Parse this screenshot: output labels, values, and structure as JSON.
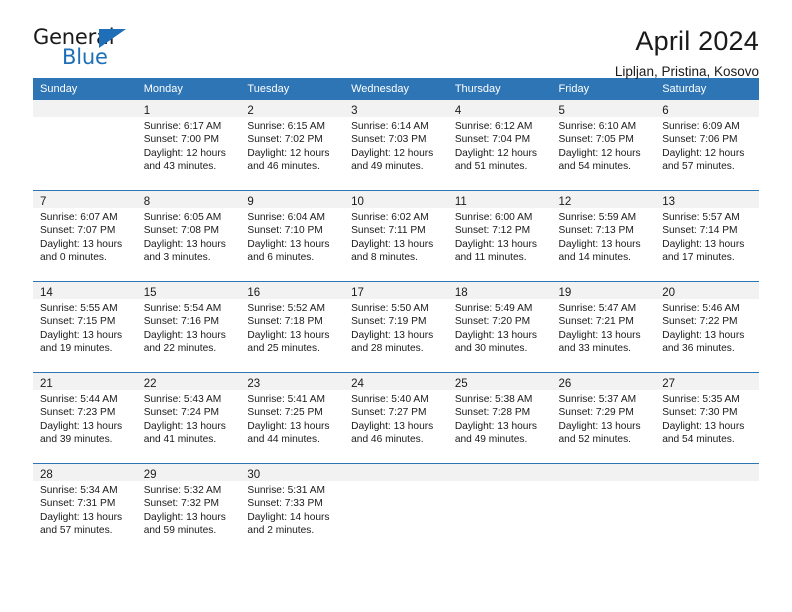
{
  "brand": {
    "name_part1": "General",
    "name_part2": "Blue",
    "accent_color": "#1E6FB8"
  },
  "header": {
    "title": "April 2024",
    "subtitle": "Lipljan, Pristina, Kosovo",
    "header_bg_color": "#2E75B6",
    "daynum_band_color": "#F2F2F2"
  },
  "weekday_headers": [
    "Sunday",
    "Monday",
    "Tuesday",
    "Wednesday",
    "Thursday",
    "Friday",
    "Saturday"
  ],
  "weeks": [
    [
      {
        "day": "",
        "sunrise": "",
        "sunset": "",
        "daylight_line1": "",
        "daylight_line2": ""
      },
      {
        "day": "1",
        "sunrise": "Sunrise: 6:17 AM",
        "sunset": "Sunset: 7:00 PM",
        "daylight_line1": "Daylight: 12 hours",
        "daylight_line2": "and 43 minutes."
      },
      {
        "day": "2",
        "sunrise": "Sunrise: 6:15 AM",
        "sunset": "Sunset: 7:02 PM",
        "daylight_line1": "Daylight: 12 hours",
        "daylight_line2": "and 46 minutes."
      },
      {
        "day": "3",
        "sunrise": "Sunrise: 6:14 AM",
        "sunset": "Sunset: 7:03 PM",
        "daylight_line1": "Daylight: 12 hours",
        "daylight_line2": "and 49 minutes."
      },
      {
        "day": "4",
        "sunrise": "Sunrise: 6:12 AM",
        "sunset": "Sunset: 7:04 PM",
        "daylight_line1": "Daylight: 12 hours",
        "daylight_line2": "and 51 minutes."
      },
      {
        "day": "5",
        "sunrise": "Sunrise: 6:10 AM",
        "sunset": "Sunset: 7:05 PM",
        "daylight_line1": "Daylight: 12 hours",
        "daylight_line2": "and 54 minutes."
      },
      {
        "day": "6",
        "sunrise": "Sunrise: 6:09 AM",
        "sunset": "Sunset: 7:06 PM",
        "daylight_line1": "Daylight: 12 hours",
        "daylight_line2": "and 57 minutes."
      }
    ],
    [
      {
        "day": "7",
        "sunrise": "Sunrise: 6:07 AM",
        "sunset": "Sunset: 7:07 PM",
        "daylight_line1": "Daylight: 13 hours",
        "daylight_line2": "and 0 minutes."
      },
      {
        "day": "8",
        "sunrise": "Sunrise: 6:05 AM",
        "sunset": "Sunset: 7:08 PM",
        "daylight_line1": "Daylight: 13 hours",
        "daylight_line2": "and 3 minutes."
      },
      {
        "day": "9",
        "sunrise": "Sunrise: 6:04 AM",
        "sunset": "Sunset: 7:10 PM",
        "daylight_line1": "Daylight: 13 hours",
        "daylight_line2": "and 6 minutes."
      },
      {
        "day": "10",
        "sunrise": "Sunrise: 6:02 AM",
        "sunset": "Sunset: 7:11 PM",
        "daylight_line1": "Daylight: 13 hours",
        "daylight_line2": "and 8 minutes."
      },
      {
        "day": "11",
        "sunrise": "Sunrise: 6:00 AM",
        "sunset": "Sunset: 7:12 PM",
        "daylight_line1": "Daylight: 13 hours",
        "daylight_line2": "and 11 minutes."
      },
      {
        "day": "12",
        "sunrise": "Sunrise: 5:59 AM",
        "sunset": "Sunset: 7:13 PM",
        "daylight_line1": "Daylight: 13 hours",
        "daylight_line2": "and 14 minutes."
      },
      {
        "day": "13",
        "sunrise": "Sunrise: 5:57 AM",
        "sunset": "Sunset: 7:14 PM",
        "daylight_line1": "Daylight: 13 hours",
        "daylight_line2": "and 17 minutes."
      }
    ],
    [
      {
        "day": "14",
        "sunrise": "Sunrise: 5:55 AM",
        "sunset": "Sunset: 7:15 PM",
        "daylight_line1": "Daylight: 13 hours",
        "daylight_line2": "and 19 minutes."
      },
      {
        "day": "15",
        "sunrise": "Sunrise: 5:54 AM",
        "sunset": "Sunset: 7:16 PM",
        "daylight_line1": "Daylight: 13 hours",
        "daylight_line2": "and 22 minutes."
      },
      {
        "day": "16",
        "sunrise": "Sunrise: 5:52 AM",
        "sunset": "Sunset: 7:18 PM",
        "daylight_line1": "Daylight: 13 hours",
        "daylight_line2": "and 25 minutes."
      },
      {
        "day": "17",
        "sunrise": "Sunrise: 5:50 AM",
        "sunset": "Sunset: 7:19 PM",
        "daylight_line1": "Daylight: 13 hours",
        "daylight_line2": "and 28 minutes."
      },
      {
        "day": "18",
        "sunrise": "Sunrise: 5:49 AM",
        "sunset": "Sunset: 7:20 PM",
        "daylight_line1": "Daylight: 13 hours",
        "daylight_line2": "and 30 minutes."
      },
      {
        "day": "19",
        "sunrise": "Sunrise: 5:47 AM",
        "sunset": "Sunset: 7:21 PM",
        "daylight_line1": "Daylight: 13 hours",
        "daylight_line2": "and 33 minutes."
      },
      {
        "day": "20",
        "sunrise": "Sunrise: 5:46 AM",
        "sunset": "Sunset: 7:22 PM",
        "daylight_line1": "Daylight: 13 hours",
        "daylight_line2": "and 36 minutes."
      }
    ],
    [
      {
        "day": "21",
        "sunrise": "Sunrise: 5:44 AM",
        "sunset": "Sunset: 7:23 PM",
        "daylight_line1": "Daylight: 13 hours",
        "daylight_line2": "and 39 minutes."
      },
      {
        "day": "22",
        "sunrise": "Sunrise: 5:43 AM",
        "sunset": "Sunset: 7:24 PM",
        "daylight_line1": "Daylight: 13 hours",
        "daylight_line2": "and 41 minutes."
      },
      {
        "day": "23",
        "sunrise": "Sunrise: 5:41 AM",
        "sunset": "Sunset: 7:25 PM",
        "daylight_line1": "Daylight: 13 hours",
        "daylight_line2": "and 44 minutes."
      },
      {
        "day": "24",
        "sunrise": "Sunrise: 5:40 AM",
        "sunset": "Sunset: 7:27 PM",
        "daylight_line1": "Daylight: 13 hours",
        "daylight_line2": "and 46 minutes."
      },
      {
        "day": "25",
        "sunrise": "Sunrise: 5:38 AM",
        "sunset": "Sunset: 7:28 PM",
        "daylight_line1": "Daylight: 13 hours",
        "daylight_line2": "and 49 minutes."
      },
      {
        "day": "26",
        "sunrise": "Sunrise: 5:37 AM",
        "sunset": "Sunset: 7:29 PM",
        "daylight_line1": "Daylight: 13 hours",
        "daylight_line2": "and 52 minutes."
      },
      {
        "day": "27",
        "sunrise": "Sunrise: 5:35 AM",
        "sunset": "Sunset: 7:30 PM",
        "daylight_line1": "Daylight: 13 hours",
        "daylight_line2": "and 54 minutes."
      }
    ],
    [
      {
        "day": "28",
        "sunrise": "Sunrise: 5:34 AM",
        "sunset": "Sunset: 7:31 PM",
        "daylight_line1": "Daylight: 13 hours",
        "daylight_line2": "and 57 minutes."
      },
      {
        "day": "29",
        "sunrise": "Sunrise: 5:32 AM",
        "sunset": "Sunset: 7:32 PM",
        "daylight_line1": "Daylight: 13 hours",
        "daylight_line2": "and 59 minutes."
      },
      {
        "day": "30",
        "sunrise": "Sunrise: 5:31 AM",
        "sunset": "Sunset: 7:33 PM",
        "daylight_line1": "Daylight: 14 hours",
        "daylight_line2": "and 2 minutes."
      },
      {
        "day": "",
        "sunrise": "",
        "sunset": "",
        "daylight_line1": "",
        "daylight_line2": ""
      },
      {
        "day": "",
        "sunrise": "",
        "sunset": "",
        "daylight_line1": "",
        "daylight_line2": ""
      },
      {
        "day": "",
        "sunrise": "",
        "sunset": "",
        "daylight_line1": "",
        "daylight_line2": ""
      },
      {
        "day": "",
        "sunrise": "",
        "sunset": "",
        "daylight_line1": "",
        "daylight_line2": ""
      }
    ]
  ]
}
